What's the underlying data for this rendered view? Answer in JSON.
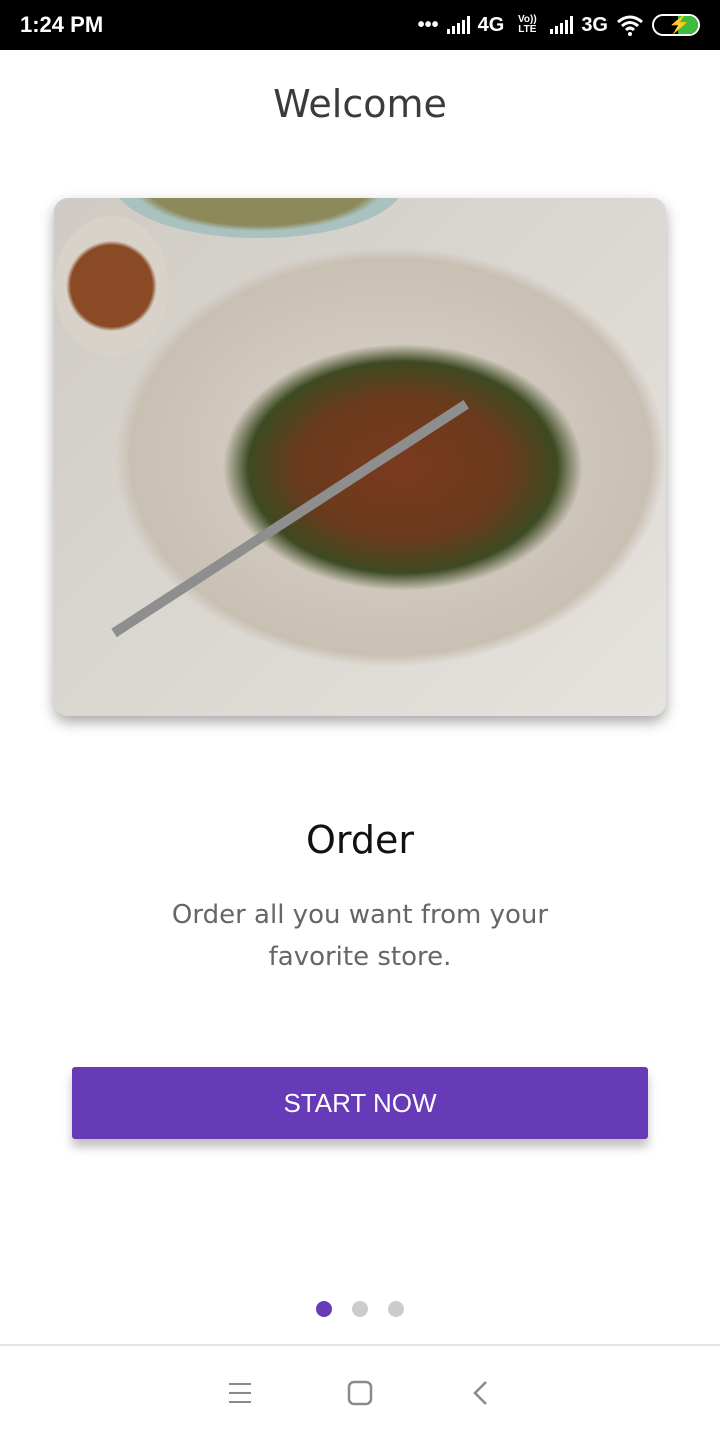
{
  "status_bar": {
    "time": "1:24 PM",
    "network1": "4G",
    "volte": "Vo)) LTE",
    "network2": "3G",
    "icons": [
      "more-dots-icon",
      "signal-icon",
      "wifi-icon",
      "battery-charging-icon"
    ],
    "battery_color": "#3dbb3d"
  },
  "header": {
    "title": "Welcome"
  },
  "slide": {
    "image_alt": "food-dish-image",
    "heading": "Order",
    "description": "Order all you want from your favorite store."
  },
  "button": {
    "label": "START NOW",
    "color": "#673ab7"
  },
  "pager": {
    "count": 3,
    "active_index": 0,
    "active_color": "#673ab7",
    "inactive_color": "#cccccc"
  },
  "navbar": {
    "icons": [
      "menu-icon",
      "home-square-icon",
      "back-chevron-icon"
    ]
  }
}
